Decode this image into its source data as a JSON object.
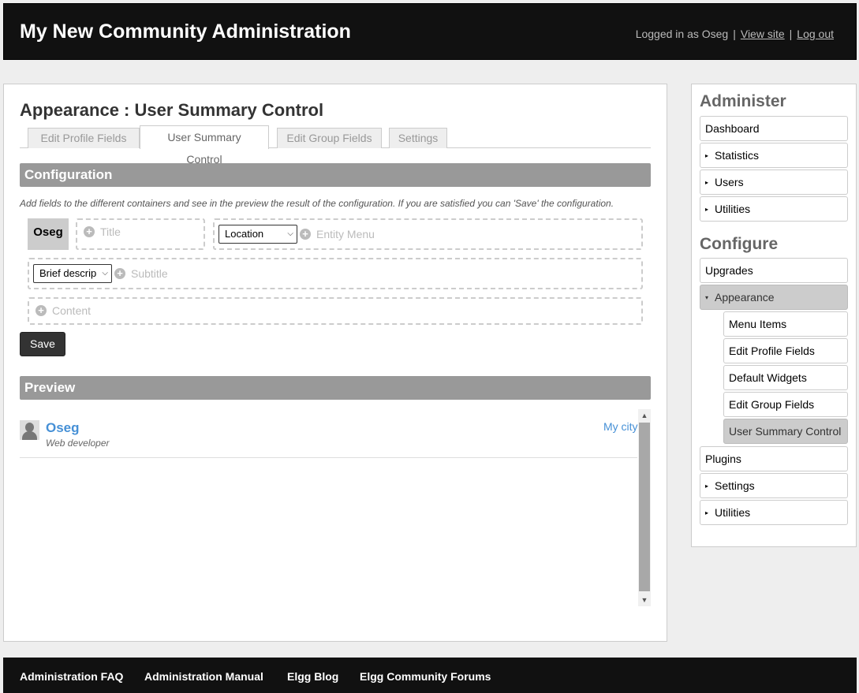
{
  "header": {
    "site_title": "My New Community Administration",
    "logged_in_text": "Logged in as Oseg",
    "separator": "|",
    "view_site": "View site",
    "log_out": "Log out"
  },
  "page": {
    "title": "Appearance : User Summary Control",
    "tabs": [
      {
        "label": "Edit Profile Fields",
        "active": false
      },
      {
        "label": "User Summary Control",
        "active": true
      },
      {
        "label": "Edit Group Fields",
        "active": false
      },
      {
        "label": "Settings",
        "active": false
      }
    ]
  },
  "configuration": {
    "heading": "Configuration",
    "help_text": "Add fields to the different containers and see in the preview the result of the configuration. If you are satisfied you can 'Save' the configuration.",
    "user_name": "Oseg",
    "title_placeholder": "Title",
    "location_select": "Location",
    "entity_menu_placeholder": "Entity Menu",
    "brief_select": "Brief descrip",
    "subtitle_placeholder": "Subtitle",
    "content_placeholder": "Content",
    "plus_glyph": "+",
    "save_label": "Save"
  },
  "preview": {
    "heading": "Preview",
    "name": "Oseg",
    "subtitle": "Web developer",
    "location": "My city"
  },
  "sidebar": {
    "administer_heading": "Administer",
    "administer_items": [
      {
        "label": "Dashboard",
        "expandable": false
      },
      {
        "label": "Statistics",
        "expandable": true
      },
      {
        "label": "Users",
        "expandable": true
      },
      {
        "label": "Utilities",
        "expandable": true
      }
    ],
    "configure_heading": "Configure",
    "configure_items": [
      {
        "label": "Upgrades"
      },
      {
        "label": "Appearance",
        "expanded": true,
        "selected": true
      },
      {
        "label": "Menu Items",
        "sub": true
      },
      {
        "label": "Edit Profile Fields",
        "sub": true
      },
      {
        "label": "Default Widgets",
        "sub": true
      },
      {
        "label": "Edit Group Fields",
        "sub": true
      },
      {
        "label": "User Summary Control",
        "sub": true,
        "selected": true
      },
      {
        "label": "Plugins"
      },
      {
        "label": "Settings",
        "expandable": true
      },
      {
        "label": "Utilities",
        "expandable": true
      }
    ],
    "collapsed_marker": "▸",
    "expanded_marker": "▾"
  },
  "footer": {
    "links": [
      "Administration FAQ",
      "Administration Manual",
      "Elgg Blog",
      "Elgg Community Forums"
    ]
  },
  "colors": {
    "accent_link": "#4690d6",
    "header_bg": "#111111",
    "section_bg": "#999999"
  }
}
